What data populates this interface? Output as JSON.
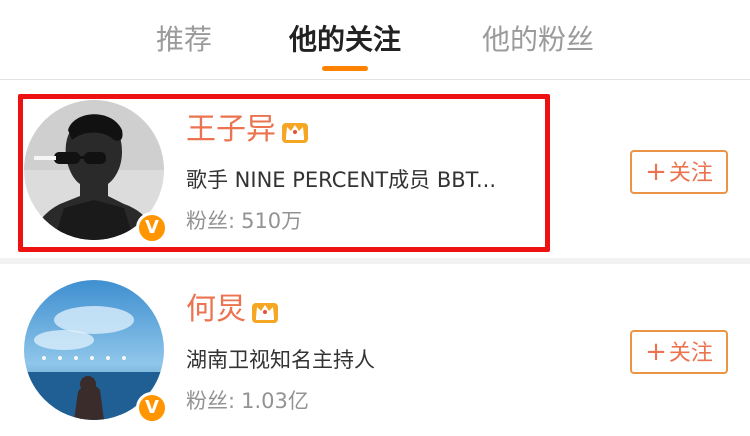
{
  "tabs": [
    {
      "label": "推荐",
      "active": false
    },
    {
      "label": "他的关注",
      "active": true
    },
    {
      "label": "他的粉丝",
      "active": false
    }
  ],
  "accent_color": "#ff8200",
  "name_color": "#eb7350",
  "highlight_color": "#ee1111",
  "users": [
    {
      "name": "王子异",
      "description": "歌手 NINE PERCENT成员 BBT...",
      "fans_label": "粉丝:",
      "fans_count": "510万",
      "verified_badge": "V",
      "follow_label": "关注",
      "follow_icon": "plus-icon",
      "name_icon": "crown-icon"
    },
    {
      "name": "何炅",
      "description": "湖南卫视知名主持人",
      "fans_label": "粉丝:",
      "fans_count": "1.03亿",
      "verified_badge": "V",
      "follow_label": "关注",
      "follow_icon": "plus-icon",
      "name_icon": "crown-icon"
    }
  ]
}
